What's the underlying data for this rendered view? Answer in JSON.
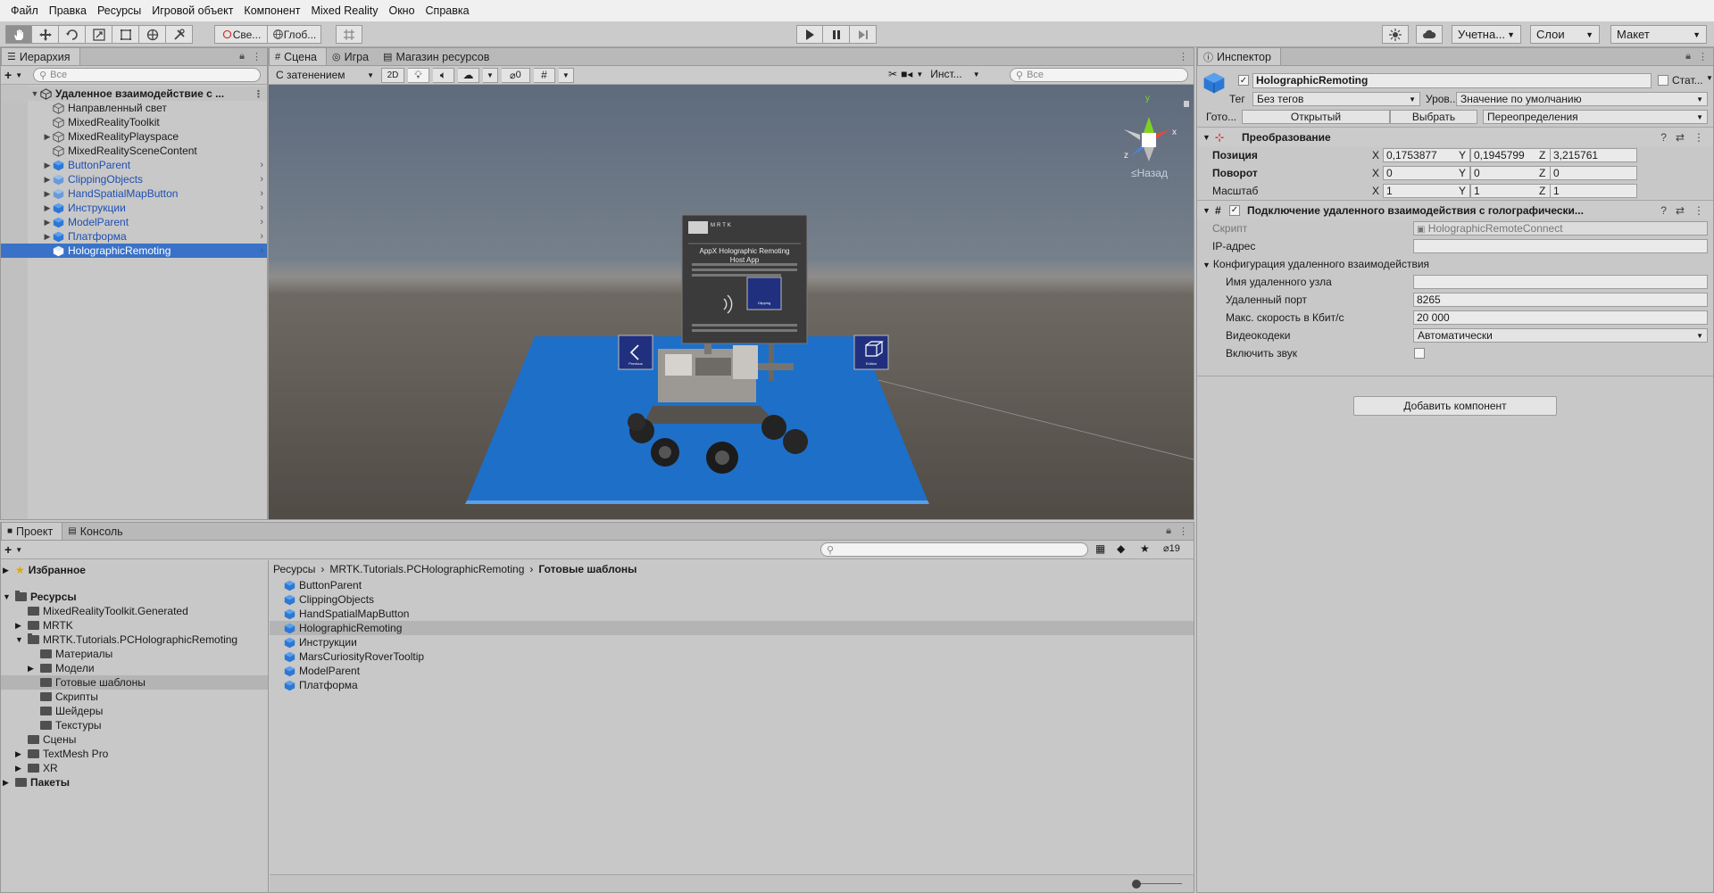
{
  "menu": [
    "Файл",
    "Правка",
    "Ресурсы",
    "Игровой объект",
    "Компонент",
    "Mixed Reality",
    "Окно",
    "Справка"
  ],
  "toolbar": {
    "pivot_label": "Све...",
    "global_label": "Глоб...",
    "account_label": "Учетна...",
    "layers_label": "Слои",
    "layout_label": "Макет"
  },
  "hierarchy": {
    "tab_label": "Иерархия",
    "search_placeholder": "Все",
    "scene_name": "Удаленное взаимодействие с ...",
    "items": [
      {
        "label": "Направленный свет",
        "type": "plain"
      },
      {
        "label": "MixedRealityToolkit",
        "type": "plain"
      },
      {
        "label": "MixedRealityPlayspace",
        "type": "plain",
        "expandable": true
      },
      {
        "label": "MixedRealitySceneContent",
        "type": "plain"
      },
      {
        "label": "ButtonParent",
        "type": "prefab",
        "expandable": true
      },
      {
        "label": "ClippingObjects",
        "type": "prefab-light",
        "expandable": true
      },
      {
        "label": "HandSpatialMapButton",
        "type": "prefab-light",
        "expandable": true
      },
      {
        "label": "Инструкции",
        "type": "prefab",
        "expandable": true
      },
      {
        "label": "ModelParent",
        "type": "prefab",
        "expandable": true
      },
      {
        "label": "Платформа",
        "type": "prefab",
        "expandable": true
      },
      {
        "label": "HolographicRemoting",
        "type": "prefab",
        "selected": true
      }
    ]
  },
  "scene": {
    "tabs": [
      "Сцена",
      "Игра",
      "Магазин ресурсов"
    ],
    "shading_mode": "С затенением",
    "mode_2d": "2D",
    "hidden_count": "0",
    "tools_label": "Инст...",
    "search_placeholder": "Все",
    "gizmo_back_label": "Назад",
    "gizmo_axes": {
      "x": "x",
      "y": "y",
      "z": "z"
    },
    "panel_title": "AppX Holographic Remoting",
    "panel_subtitle": "Host App",
    "panel_logo": "MRTK",
    "left_button_label": "Previous",
    "right_button_label": "Edition",
    "center_button_label": "Clipping"
  },
  "inspector": {
    "tab_label": "Инспектор",
    "object_name": "HolographicRemoting",
    "static_label": "Стат...",
    "tag_label": "Тег",
    "tag_value": "Без тегов",
    "layer_label": "Уров...",
    "layer_value": "Значение по умолчанию",
    "prefab_label": "Гото...",
    "open_btn": "Открытый",
    "select_btn": "Выбрать",
    "overrides_btn": "Переопределения",
    "transform": {
      "title": "Преобразование",
      "position_label": "Позиция",
      "rotation_label": "Поворот",
      "scale_label": "Масштаб",
      "position": {
        "x": "0,1753877",
        "y": "0,1945799",
        "z": "3,215761"
      },
      "rotation": {
        "x": "0",
        "y": "0",
        "z": "0"
      },
      "scale": {
        "x": "1",
        "y": "1",
        "z": "1"
      }
    },
    "remote": {
      "title": "Подключение удаленного взаимодействия с голографически...",
      "script_label": "Скрипт",
      "script_value": "HolographicRemoteConnect",
      "ip_label": "IP-адрес",
      "ip_value": "",
      "config_label": "Конфигурация удаленного взаимодействия",
      "host_label": "Имя удаленного узла",
      "host_value": "",
      "port_label": "Удаленный порт",
      "port_value": "8265",
      "bitrate_label": "Макс. скорость в Кбит/с",
      "bitrate_value": "20 000",
      "codec_label": "Видеокодеки",
      "codec_value": "Автоматически",
      "audio_label": "Включить звук"
    },
    "add_component": "Добавить компонент"
  },
  "project": {
    "tabs": [
      "Проект",
      "Консоль"
    ],
    "hidden_count": "19",
    "tree": {
      "favorites": "Избранное",
      "assets": "Ресурсы",
      "mrtk_generated": "MixedRealityToolkit.Generated",
      "mrtk": "MRTK",
      "tutorials": "MRTK.Tutorials.PCHolographicRemoting",
      "materials": "Материалы",
      "models": "Модели",
      "prefabs": "Готовые шаблоны",
      "scripts": "Скрипты",
      "shaders": "Шейдеры",
      "textures": "Текстуры",
      "scenes": "Сцены",
      "textmesh": "TextMesh Pro",
      "xr": "XR",
      "packages": "Пакеты"
    },
    "breadcrumb": [
      "Ресурсы",
      "MRTK.Tutorials.PCHolographicRemoting",
      "Готовые шаблоны"
    ],
    "files": [
      "ButtonParent",
      "ClippingObjects",
      "HandSpatialMapButton",
      "HolographicRemoting",
      "Инструкции",
      "MarsCuriosityRoverTooltip",
      "ModelParent",
      "Платформа"
    ],
    "selected_file_index": 3
  },
  "colors": {
    "selection": "#3a72c7",
    "prefab_blue": "#1f4fb0",
    "platform_blue": "#1e6fc8"
  }
}
